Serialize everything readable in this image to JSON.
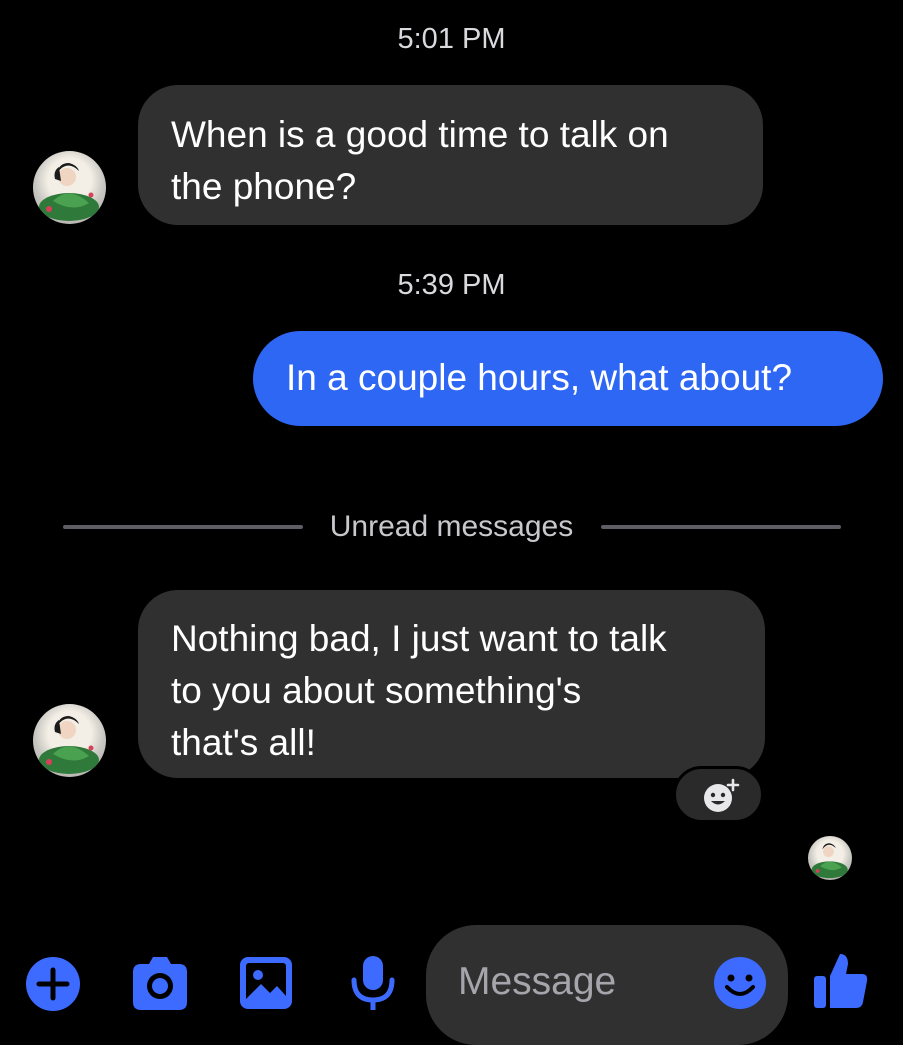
{
  "conversation": {
    "timestamps": [
      "5:01 PM",
      "5:39 PM"
    ],
    "messages": [
      {
        "direction": "incoming",
        "lines": [
          "When is a good time to talk on",
          "the phone?"
        ]
      },
      {
        "direction": "outgoing",
        "text": "In a couple hours, what about?"
      },
      {
        "direction": "incoming",
        "lines": [
          "Nothing bad, I just want to talk",
          "to you about something's",
          "that's all!"
        ]
      }
    ],
    "unread_divider": "Unread messages"
  },
  "composer": {
    "placeholder": "Message",
    "icons": [
      "plus-icon",
      "camera-icon",
      "gallery-icon",
      "microphone-icon",
      "emoji-icon",
      "thumbs-up-icon"
    ]
  },
  "colors": {
    "background": "#000000",
    "incoming_bubble": "#303030",
    "outgoing_bubble": "#2f67f5",
    "accent": "#3d6bff"
  }
}
